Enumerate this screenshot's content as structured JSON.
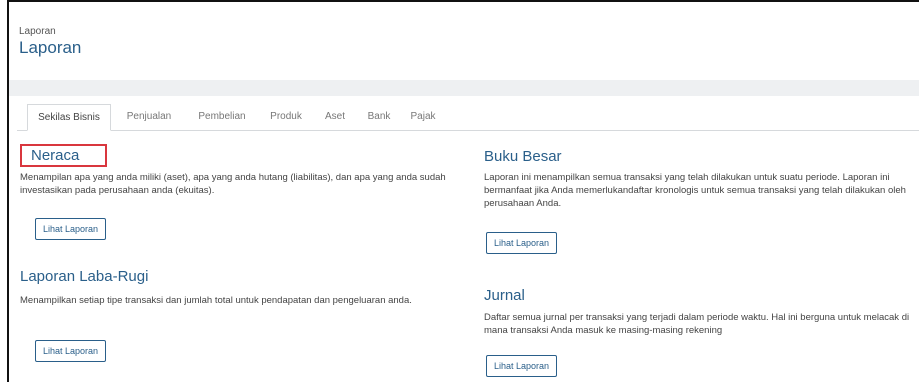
{
  "header": {
    "breadcrumb": "Laporan",
    "title": "Laporan"
  },
  "tabs": [
    {
      "label": "Sekilas Bisnis",
      "active": true
    },
    {
      "label": "Penjualan"
    },
    {
      "label": "Pembelian"
    },
    {
      "label": "Produk"
    },
    {
      "label": "Aset"
    },
    {
      "label": "Bank"
    },
    {
      "label": "Pajak"
    }
  ],
  "reports": {
    "neraca": {
      "title": "Neraca",
      "description": "Menampilan apa yang anda miliki (aset), apa yang anda hutang (liabilitas), dan apa yang anda sudah investasikan pada perusahaan anda (ekuitas).",
      "button": "Lihat Laporan"
    },
    "laba_rugi": {
      "title": "Laporan Laba-Rugi",
      "description": "Menampilkan setiap tipe transaksi dan jumlah total untuk pendapatan dan pengeluaran anda.",
      "button": "Lihat Laporan"
    },
    "buku_besar": {
      "title": "Buku Besar",
      "description": "Laporan ini menampilkan semua transaksi yang telah dilakukan untuk suatu periode. Laporan ini bermanfaat jika Anda memerlukandaftar kronologis untuk semua transaksi yang telah dilakukan oleh perusahaan Anda.",
      "button": "Lihat Laporan"
    },
    "jurnal": {
      "title": "Jurnal",
      "description": "Daftar semua jurnal per transaksi yang terjadi dalam periode waktu. Hal ini berguna untuk melacak di mana transaksi Anda masuk ke masing-masing rekening",
      "button": "Lihat Laporan"
    }
  },
  "colors": {
    "accent": "#2a5f8a",
    "highlight_border": "#d9363e",
    "band": "#eef0f2"
  }
}
